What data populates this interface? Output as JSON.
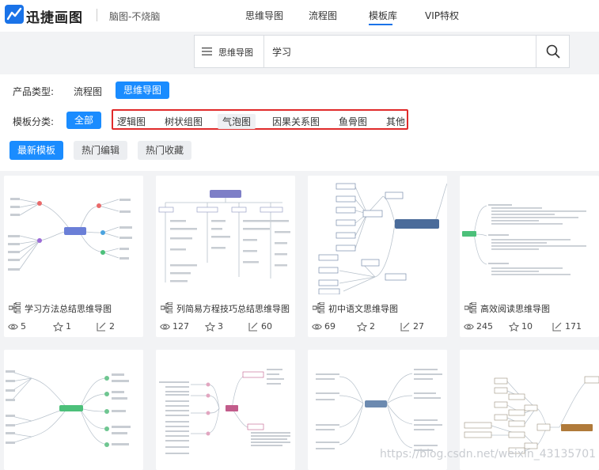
{
  "header": {
    "brand": "迅捷画图",
    "slogan": "脑图-不烧脑",
    "nav": [
      "思维导图",
      "流程图",
      "模板库",
      "VIP特权"
    ],
    "active_nav": "模板库",
    "accent": "#1a73e8"
  },
  "search": {
    "type_label": "思维导图",
    "query": "学习",
    "icons": [
      "menu-icon",
      "search-icon"
    ]
  },
  "filters": {
    "product_label": "产品类型:",
    "products": [
      "流程图",
      "思维导图"
    ],
    "active_product": "思维导图",
    "category_label": "模板分类:",
    "categories": [
      "全部",
      "逻辑图",
      "树状组图",
      "气泡图",
      "因果关系图",
      "鱼骨图",
      "其他"
    ],
    "active_category": "全部",
    "highlight_color": "#e02b2b",
    "sorts": [
      "最新模板",
      "热门编辑",
      "热门收藏"
    ],
    "active_sort": "最新模板"
  },
  "cards": [
    {
      "title": "学习方法总结思维导图",
      "views": "5",
      "stars": "1",
      "edits": "2"
    },
    {
      "title": "列简易方程技巧总结思维导图",
      "views": "127",
      "stars": "3",
      "edits": "60"
    },
    {
      "title": "初中语文思维导图",
      "views": "69",
      "stars": "2",
      "edits": "27"
    },
    {
      "title": "高效阅读思维导图",
      "views": "245",
      "stars": "10",
      "edits": "171"
    }
  ],
  "watermark": "https://blog.csdn.net/weixin_43135701"
}
